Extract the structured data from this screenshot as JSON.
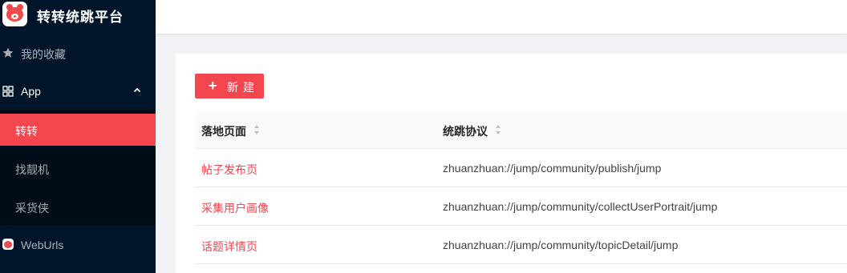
{
  "app": {
    "title": "转转统跳平台"
  },
  "sidebar": {
    "favorites_label": "我的收藏",
    "app_group_label": "App",
    "sub_items": [
      {
        "label": "转转",
        "active": true
      },
      {
        "label": "找靓机",
        "active": false
      },
      {
        "label": "采货侠",
        "active": false
      }
    ],
    "weburls_label": "WebUrls"
  },
  "toolbar": {
    "new_label": "新建"
  },
  "table": {
    "columns": [
      "落地页面",
      "统跳协议"
    ],
    "rows": [
      {
        "page": "帖子发布页",
        "protocol": "zhuanzhuan://jump/community/publish/jump"
      },
      {
        "page": "采集用户画像",
        "protocol": "zhuanzhuan://jump/community/collectUserPortrait/jump"
      },
      {
        "page": "话题详情页",
        "protocol": "zhuanzhuan://jump/community/topicDetail/jump"
      }
    ]
  },
  "colors": {
    "accent": "#f4464f",
    "sidebar_bg": "#001529",
    "submenu_bg": "#000c17"
  }
}
